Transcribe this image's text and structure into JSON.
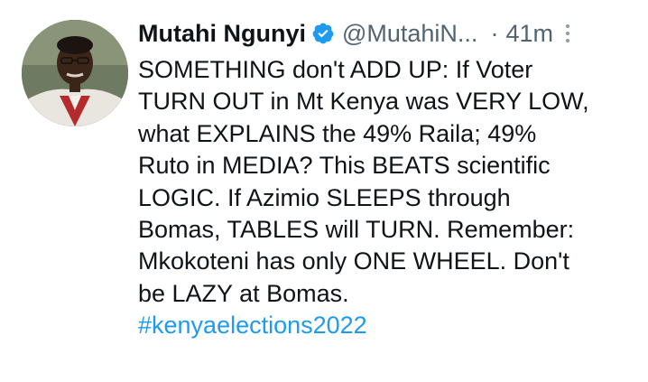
{
  "tweet": {
    "author_name": "Mutahi Ngunyi",
    "handle": "@MutahiN...",
    "separator": "·",
    "time": "41m",
    "verified_icon": "verified-badge-icon",
    "more_icon": "more-vertical-icon",
    "text": "SOMETHING don't ADD UP: If Voter\nTURN OUT in Mt Kenya was VERY LOW,\nwhat EXPLAINS the 49% Raila; 49%\nRuto in MEDIA? This BEATS scientific\nLOGIC. If Azimio SLEEPS through\nBomas, TABLES will TURN.  Remember:\nMkokoteni has only ONE WHEEL. Don't\nbe LAZY at Bomas.",
    "hashtag": "#kenyaelections2022",
    "colors": {
      "text": "#0f1419",
      "secondary": "#536471",
      "link": "#1d9bf0",
      "verified": "#1d9bf0"
    }
  }
}
